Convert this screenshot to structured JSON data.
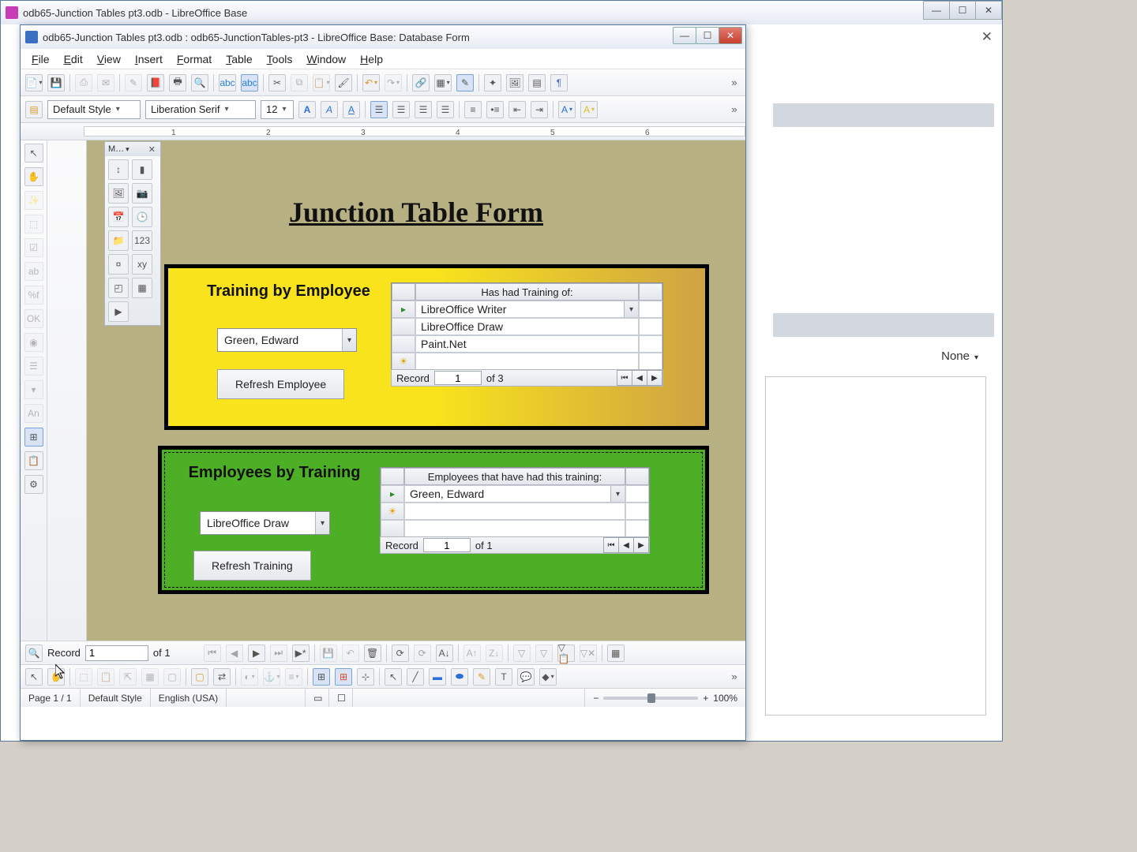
{
  "outerTitle": "odb65-Junction Tables pt3.odb - LibreOffice Base",
  "formTitle": "odb65-Junction Tables pt3.odb : odb65-JunctionTables-pt3 - LibreOffice Base: Database Form",
  "menu": [
    "File",
    "Edit",
    "View",
    "Insert",
    "Format",
    "Table",
    "Tools",
    "Window",
    "Help"
  ],
  "format": {
    "style": "Default Style",
    "font": "Liberation Serif",
    "size": "12"
  },
  "miniHeader": "M…",
  "canvas": {
    "title": "Junction Table Form",
    "yellow": {
      "label": "Training by Employee",
      "combo": "Green, Edward",
      "button": "Refresh Employee",
      "gridHeader": "Has had Training of:",
      "rows": [
        "LibreOffice Writer",
        "LibreOffice Draw",
        "Paint.Net"
      ],
      "recLabel": "Record",
      "recNum": "1",
      "recTotal": "of 3"
    },
    "green": {
      "label": "Employees by Training",
      "combo": "LibreOffice Draw",
      "button": "Refresh Training",
      "gridHeader": "Employees that have had this training:",
      "rows": [
        "Green, Edward"
      ],
      "recLabel": "Record",
      "recNum": "1",
      "recTotal": "of 1"
    }
  },
  "navBar": {
    "recLabel": "Record",
    "recNum": "1",
    "recTotal": "of  1"
  },
  "status": {
    "page": "Page 1 / 1",
    "style": "Default Style",
    "lang": "English (USA)",
    "zoom": "100%"
  },
  "sidebar": {
    "none": "None"
  }
}
